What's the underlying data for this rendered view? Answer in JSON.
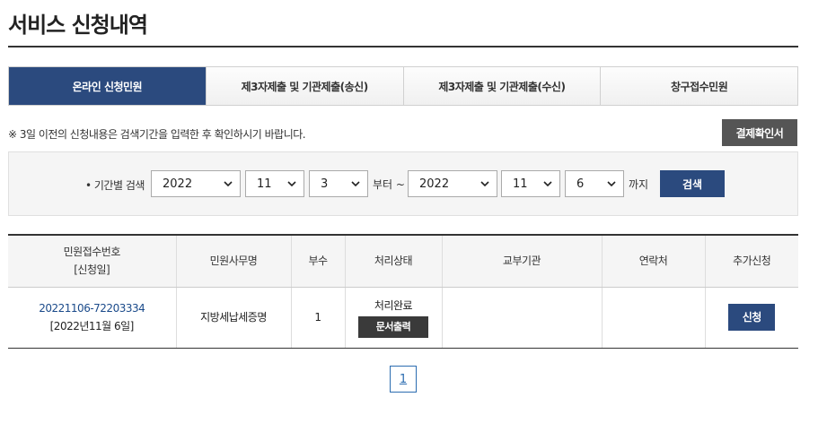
{
  "page": {
    "title": "서비스 신청내역"
  },
  "tabs": [
    {
      "label": "온라인 신청민원",
      "active": true
    },
    {
      "label": "제3자제출 및 기관제출(송신)",
      "active": false
    },
    {
      "label": "제3자제출 및 기관제출(수신)",
      "active": false
    },
    {
      "label": "창구접수민원",
      "active": false
    }
  ],
  "notice": "※ 3일 이전의 신청내용은 검색기간을 입력한 후 확인하시기 바랍니다.",
  "receipt_button": "결제확인서",
  "search": {
    "label": "• 기간별 검색",
    "from_year": "2022",
    "from_month": "11",
    "from_day": "3",
    "from_suffix": "부터 ~",
    "to_year": "2022",
    "to_month": "11",
    "to_day": "6",
    "to_suffix": "까지",
    "button": "검색"
  },
  "table": {
    "headers": {
      "receipt_no": "민원접수번호",
      "request_date": "[신청일]",
      "service_name": "민원사무명",
      "copies": "부수",
      "status": "처리상태",
      "issuing_org": "교부기관",
      "contact": "연락처",
      "additional": "추가신청"
    },
    "rows": [
      {
        "receipt_no": "20221106-72203334",
        "request_date": "[2022년11월 6일]",
        "service_name": "지방세납세증명",
        "copies": "1",
        "status": "처리완료",
        "print_button": "문서출력",
        "issuing_org": "",
        "contact": "",
        "apply_button": "신청"
      }
    ]
  },
  "pagination": {
    "current": "1"
  }
}
